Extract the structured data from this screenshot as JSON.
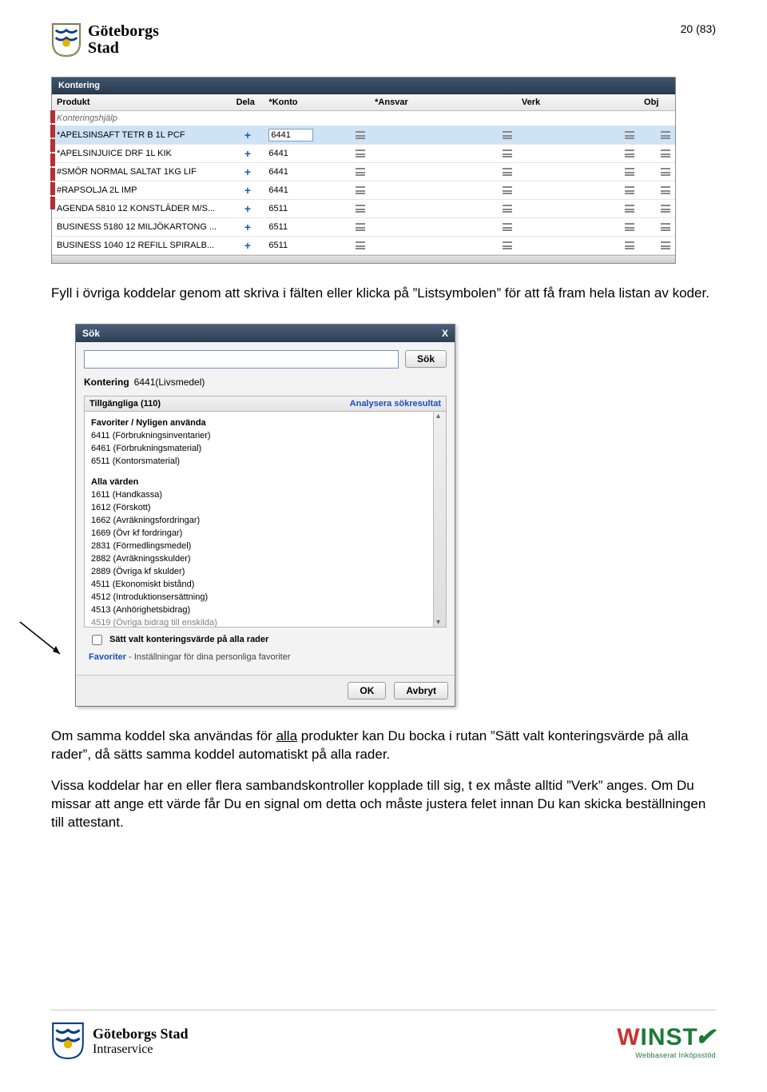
{
  "page_number": "20 (83)",
  "logo_top": {
    "l1": "Göteborgs",
    "l2": "Stad"
  },
  "kontering": {
    "title": "Kontering",
    "columns": {
      "produkt": "Produkt",
      "dela": "Dela",
      "konto": "*Konto",
      "ansvar": "*Ansvar",
      "verk": "Verk",
      "obj": "Obj"
    },
    "help_row": "Konteringshjälp",
    "rows": [
      {
        "produkt": "*APELSINSAFT TETR B 1L   PCF",
        "konto": "6441",
        "selected": true
      },
      {
        "produkt": "*APELSINJUICE DRF  1L    KIK",
        "konto": "6441"
      },
      {
        "produkt": "#SMÖR NORMAL SALTAT 1KG   LIF",
        "konto": "6441"
      },
      {
        "produkt": "#RAPSOLJA        2L    IMP",
        "konto": "6441"
      },
      {
        "produkt": "AGENDA 5810 12 KONSTLÄDER M/S...",
        "konto": "6511"
      },
      {
        "produkt": "BUSINESS 5180 12 MILJÖKARTONG ...",
        "konto": "6511"
      },
      {
        "produkt": "BUSINESS 1040 12 REFILL SPIRALB...",
        "konto": "6511"
      }
    ]
  },
  "para1": "Fyll i övriga koddelar genom att skriva i fälten eller klicka på ”Listsymbolen” för att få fram hela listan av koder.",
  "dialog": {
    "title": "Sök",
    "search_placeholder": "",
    "search_btn": "Sök",
    "kont_label": "Kontering",
    "kont_value": "6441(Livsmedel)",
    "available": "Tillgängliga (110)",
    "analysera": "Analysera sökresultat",
    "fav_head": "Favoriter / Nyligen använda",
    "favorites": [
      "6411 (Förbrukningsinventarier)",
      "6461 (Förbrukningsmaterial)",
      "6511 (Kontorsmaterial)"
    ],
    "all_head": "Alla värden",
    "all": [
      "1611 (Handkassa)",
      "1612 (Förskott)",
      "1662 (Avräkningsfordringar)",
      "1669 (Övr kf fordringar)",
      "2831 (Förmedlingsmedel)",
      "2882 (Avräkningsskulder)",
      "2889 (Övriga kf skulder)",
      "4511 (Ekonomiskt bistånd)",
      "4512 (Introduktionsersättning)",
      "4513 (Anhörighetsbidrag)"
    ],
    "all_cut": "4519 (Övriga bidrag till enskilda)",
    "checkbox": "Sätt valt konteringsvärde på alla rader",
    "fav_line_bold": "Favoriter",
    "fav_line_rest": " - Inställningar för dina personliga favoriter",
    "ok": "OK",
    "cancel": "Avbryt"
  },
  "para2_a": "Om samma koddel ska användas för ",
  "para2_alla": "alla",
  "para2_b": " produkter kan Du bocka i rutan ”Sätt valt konteringsvärde på alla rader”, då sätts samma koddel automatiskt på alla rader.",
  "para3": "Vissa koddelar har en eller flera sambandskontroller kopplade till sig, t ex måste alltid ”Verk” anges. Om Du missar att ange ett värde får Du en signal om detta och måste justera felet innan Du kan skicka beställningen till attestant.",
  "footer": {
    "brand1": "Göteborgs Stad",
    "brand2": "Intraservice",
    "winst": "W",
    "winst_rest": "INST",
    "winst_sub": "Webbaserat Inköpsstöd"
  }
}
